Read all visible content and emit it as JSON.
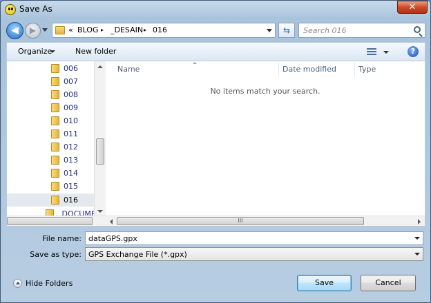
{
  "window": {
    "title": "Save As",
    "close_label": "✕"
  },
  "address_bar": {
    "overflow": "«",
    "crumbs": [
      "BLOG",
      "_DESAIN",
      "016"
    ],
    "separator": "▸"
  },
  "search": {
    "placeholder": "Search 016"
  },
  "toolbar": {
    "organize": "Organize",
    "new_folder": "New folder",
    "help": "?"
  },
  "tree": {
    "items": [
      {
        "label": "006",
        "selected": false
      },
      {
        "label": "007",
        "selected": false
      },
      {
        "label": "008",
        "selected": false
      },
      {
        "label": "009",
        "selected": false
      },
      {
        "label": "010",
        "selected": false
      },
      {
        "label": "011",
        "selected": false
      },
      {
        "label": "012",
        "selected": false
      },
      {
        "label": "013",
        "selected": false
      },
      {
        "label": "014",
        "selected": false
      },
      {
        "label": "015",
        "selected": false
      },
      {
        "label": "016",
        "selected": true
      }
    ],
    "parent_item": "_DOCUMEI"
  },
  "file_list": {
    "columns": [
      "Name",
      "Date modified",
      "Type"
    ],
    "empty_message": "No items match your search.",
    "hscroll_grip": "III"
  },
  "form": {
    "file_name_label": "File name:",
    "file_name_value": "dataGPS.gpx",
    "save_type_label": "Save as type:",
    "save_type_value": "GPS Exchange File (*.gpx)"
  },
  "footer": {
    "hide_folders": "Hide Folders",
    "save": "Save",
    "cancel": "Cancel"
  }
}
